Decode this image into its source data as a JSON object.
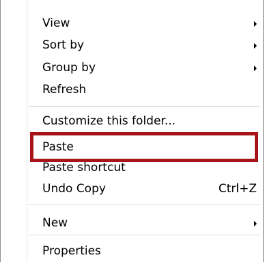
{
  "context_menu": {
    "items": [
      {
        "label": "View",
        "submenu": true
      },
      {
        "label": "Sort by",
        "submenu": true
      },
      {
        "label": "Group by",
        "submenu": true
      },
      {
        "label": "Refresh"
      },
      {
        "label": "Customize this folder..."
      },
      {
        "label": "Paste"
      },
      {
        "label": "Paste shortcut"
      },
      {
        "label": "Undo Copy",
        "shortcut": "Ctrl+Z"
      },
      {
        "label": "New",
        "submenu": true
      },
      {
        "label": "Properties"
      }
    ]
  },
  "annotation": {
    "target": "Paste",
    "color": "#a6141a"
  }
}
